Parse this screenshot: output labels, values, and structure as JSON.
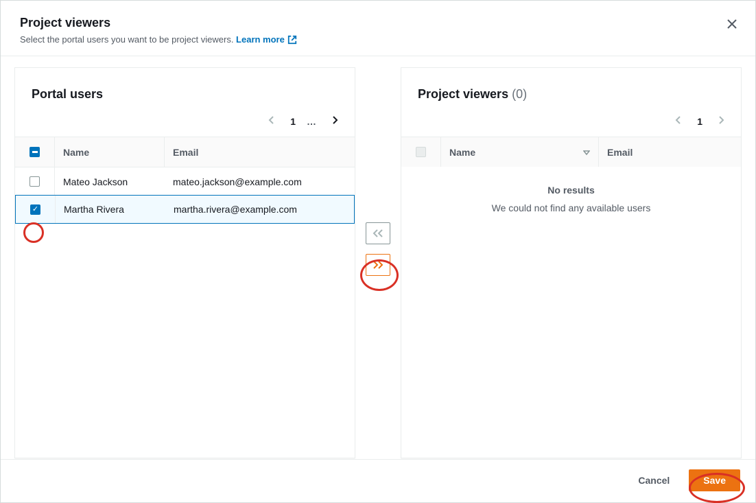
{
  "header": {
    "title": "Project viewers",
    "subtitle_pre": "Select the portal users you want to be project viewers. ",
    "learn_more_label": "Learn more"
  },
  "left_panel": {
    "title": "Portal users",
    "columns": {
      "name": "Name",
      "email": "Email"
    },
    "pagination": {
      "current": "1",
      "ellipsis": "…"
    },
    "rows": [
      {
        "name": "Mateo Jackson",
        "email": "mateo.jackson@example.com",
        "checked": false
      },
      {
        "name": "Martha Rivera",
        "email": "martha.rivera@example.com",
        "checked": true
      }
    ]
  },
  "right_panel": {
    "title_pre": "Project viewers ",
    "count_label": "(0)",
    "columns": {
      "name": "Name",
      "email": "Email"
    },
    "pagination": {
      "current": "1"
    },
    "empty": {
      "title": "No results",
      "message": "We could not find any available users"
    }
  },
  "footer": {
    "cancel_label": "Cancel",
    "save_label": "Save"
  }
}
